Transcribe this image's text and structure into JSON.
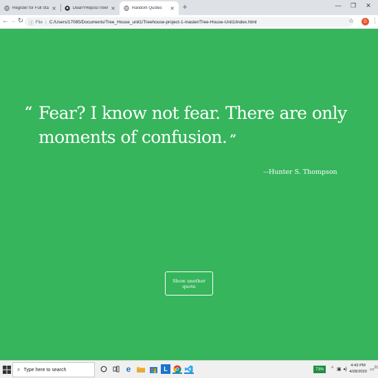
{
  "browser": {
    "tabs": [
      {
        "title": "Register for Full Stack Conf",
        "active": false
      },
      {
        "title": "DeanYRepos/Treehouse-project-",
        "active": false
      },
      {
        "title": "Random Quotes",
        "active": true
      }
    ],
    "new_tab": "+",
    "window_controls": [
      "—",
      "❐",
      "✕"
    ],
    "address": {
      "scheme": "File",
      "path": "C:/Users/17085/Documents/Tree_House_unit1/Treehouse-project-1-master/Tree-House-Unit1/index.html"
    },
    "profile_initial": "D"
  },
  "page": {
    "quote": "Fear? I know not fear. There are only moments of confusion.",
    "open_mark": "“",
    "close_mark": "”",
    "source": "–-Hunter S. Thompson",
    "button_label": "Show another quote",
    "background_color": "#36b55c"
  },
  "taskbar": {
    "search_placeholder": "Type here to search",
    "battery": "73%",
    "time": "4:43 PM",
    "date": "4/28/2020",
    "notification_count": "21"
  }
}
